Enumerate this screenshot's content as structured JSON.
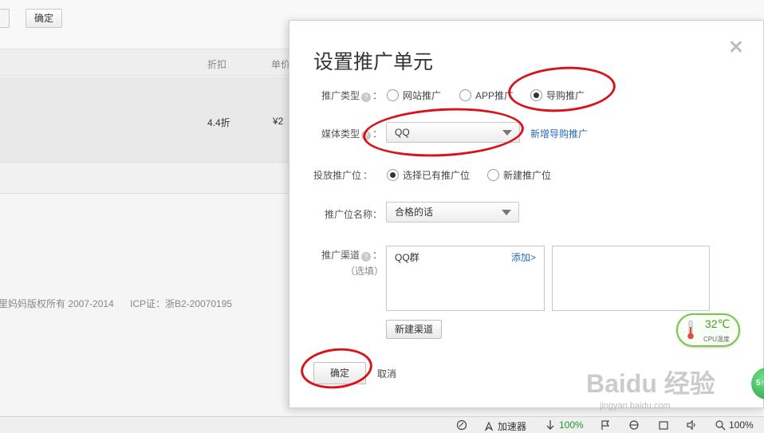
{
  "background": {
    "top_button_label": "确定",
    "table_headers": [
      "折扣",
      "单价"
    ],
    "row_values": [
      "4.4折",
      "¥2"
    ],
    "footer_copyright": "里妈妈版权所有 2007-2014",
    "footer_icp": "ICP证：浙B2-20070195"
  },
  "dialog": {
    "title": "设置推广单元",
    "close_icon": "close-icon",
    "promo_type": {
      "label": "推广类型",
      "options": [
        "网站推广",
        "APP推广",
        "导购推广"
      ],
      "selected": "导购推广"
    },
    "media_type": {
      "label": "媒体类型",
      "value": "QQ",
      "link": "新增导购推广"
    },
    "placement": {
      "label": "投放推广位",
      "options": [
        "选择已有推广位",
        "新建推广位"
      ],
      "selected": "选择已有推广位"
    },
    "placement_name": {
      "label": "推广位名称：",
      "value": "合格的话"
    },
    "channel": {
      "label": "推广渠道",
      "optional_note": "（选填）",
      "items": [
        "QQ群"
      ],
      "add_link": "添加>",
      "new_channel_button": "新建渠道"
    },
    "confirm_button": "确定",
    "cancel_link": "取消"
  },
  "widgets": {
    "cpu_temp": "32℃",
    "cpu_temp_label": "CPU温度",
    "side_ball_text": "5↑"
  },
  "watermark": {
    "text": "Baidu 经验",
    "sub": "jingyan.baidu.com"
  },
  "statusbar": {
    "accelerator": "加速器",
    "download_pct": "100%",
    "zoom": "100%"
  },
  "colors": {
    "annotation_red": "#d8141b",
    "link_blue": "#2a6bb5",
    "temp_green": "#7cc24e"
  }
}
